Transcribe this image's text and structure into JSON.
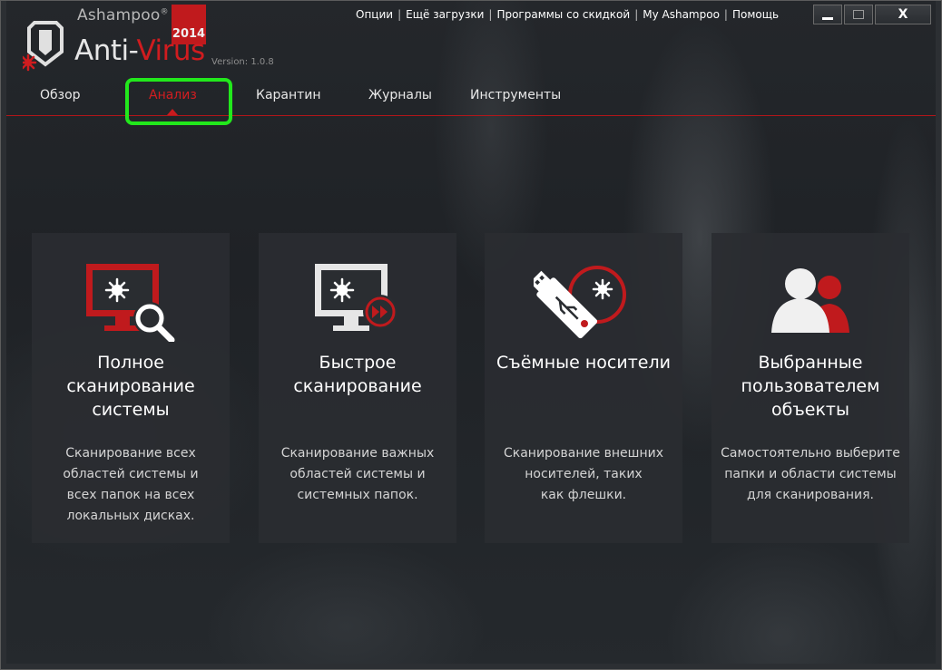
{
  "logo": {
    "brand": "Ashampoo",
    "registered": "®",
    "product_part1": "Anti-",
    "product_part2": "Virus",
    "year": "2014",
    "version": "Version: 1.0.8"
  },
  "top_links": [
    "Опции",
    "Ещё загрузки",
    "Программы со скидкой",
    "My Ashampoo",
    "Помощь"
  ],
  "window_controls": {
    "close": "X"
  },
  "nav": [
    {
      "label": "Обзор",
      "active": false
    },
    {
      "label": "Анализ",
      "active": true
    },
    {
      "label": "Карантин",
      "active": false
    },
    {
      "label": "Журналы",
      "active": false
    },
    {
      "label": "Инструменты",
      "active": false
    }
  ],
  "colors": {
    "accent": "#d21d20",
    "highlight": "#22e81c",
    "background": "#1f2226"
  },
  "cards": [
    {
      "icon": "monitor-scan-icon",
      "title": [
        "Полное",
        "сканирование",
        "системы"
      ],
      "description": [
        "Сканирование всех",
        "областей системы и",
        "всех папок на всех",
        "локальных дисках."
      ]
    },
    {
      "icon": "monitor-fast-forward-icon",
      "title": [
        "Быстрое",
        "сканирование"
      ],
      "description": [
        "Сканирование важных",
        "областей системы и",
        "системных папок."
      ]
    },
    {
      "icon": "usb-drive-icon",
      "title": [
        "Съёмные носители"
      ],
      "description": [
        "Сканирование внешних",
        "носителей, таких",
        "как флешки."
      ]
    },
    {
      "icon": "users-icon",
      "title": [
        "Выбранные",
        "пользователем",
        "объекты"
      ],
      "description": [
        "Самостоятельно выберите",
        "папки и области системы",
        "для сканирования."
      ]
    }
  ]
}
